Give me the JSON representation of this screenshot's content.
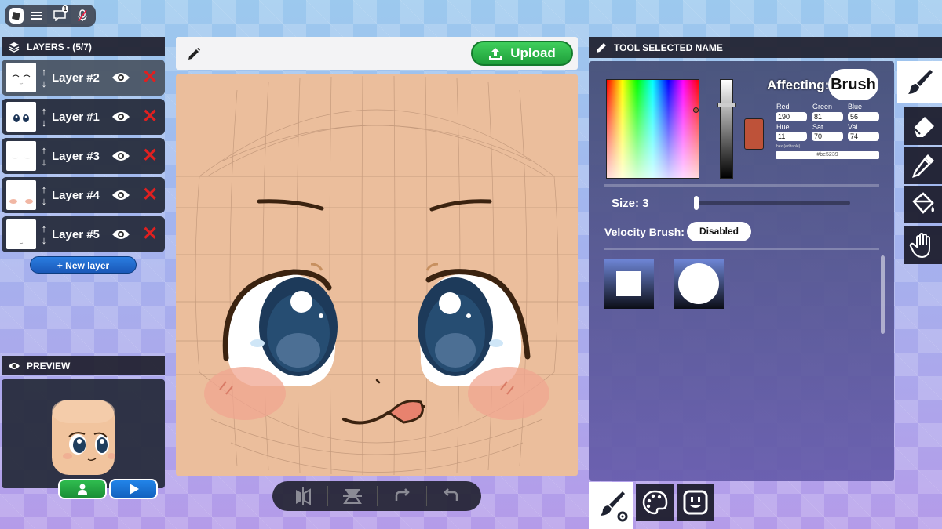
{
  "colors": {
    "selected_color": "#be5239",
    "panel_bg": "#232837",
    "skin": "#ebbe9c",
    "upload_green": "#2fbc4f",
    "delete_red": "#e02020"
  },
  "topbar": {
    "notification_count": "1",
    "icons": [
      "roblox-logo-icon",
      "menu-icon",
      "chat-icon",
      "mic-muted-icon"
    ]
  },
  "layers": {
    "title": "LAYERS - (5/7)",
    "items": [
      {
        "label": "Layer #2",
        "selected": true
      },
      {
        "label": "Layer #1",
        "selected": false
      },
      {
        "label": "Layer #3",
        "selected": false
      },
      {
        "label": "Layer #4",
        "selected": false
      },
      {
        "label": "Layer #5",
        "selected": false
      }
    ],
    "new_layer_label": "+ New layer"
  },
  "preview": {
    "title": "PREVIEW"
  },
  "canvas": {
    "upload_label": "Upload"
  },
  "tool_panel": {
    "title": "TOOL SELECTED NAME",
    "affecting_label": "Affecting:",
    "affecting_value": "Brush",
    "red_label": "Red",
    "red_value": "190",
    "green_label": "Green",
    "green_value": "81",
    "blue_label": "Blue",
    "blue_value": "56",
    "hue_label": "Hue",
    "hue_value": "11",
    "sat_label": "Sat",
    "sat_value": "70",
    "val_label": "Val",
    "val_value": "74",
    "hex_label": "hex (editable)",
    "hex_value": "#be5239",
    "size_label": "Size: 3",
    "size_slider_fraction": 0.03,
    "velocity_label": "Velocity Brush:",
    "velocity_value": "Disabled",
    "brush_shapes": [
      "square-brush-shape",
      "circle-brush-shape"
    ]
  },
  "side_tools": [
    "brush-icon",
    "eraser-icon",
    "eyedropper-icon",
    "paint-bucket-icon",
    "hand-icon"
  ],
  "bottom_tabs": [
    "brush-settings-icon",
    "palette-icon",
    "face-icon"
  ],
  "bottom_toolbar": [
    "flip-horizontal-icon",
    "flip-vertical-icon",
    "redo-icon",
    "undo-icon"
  ]
}
